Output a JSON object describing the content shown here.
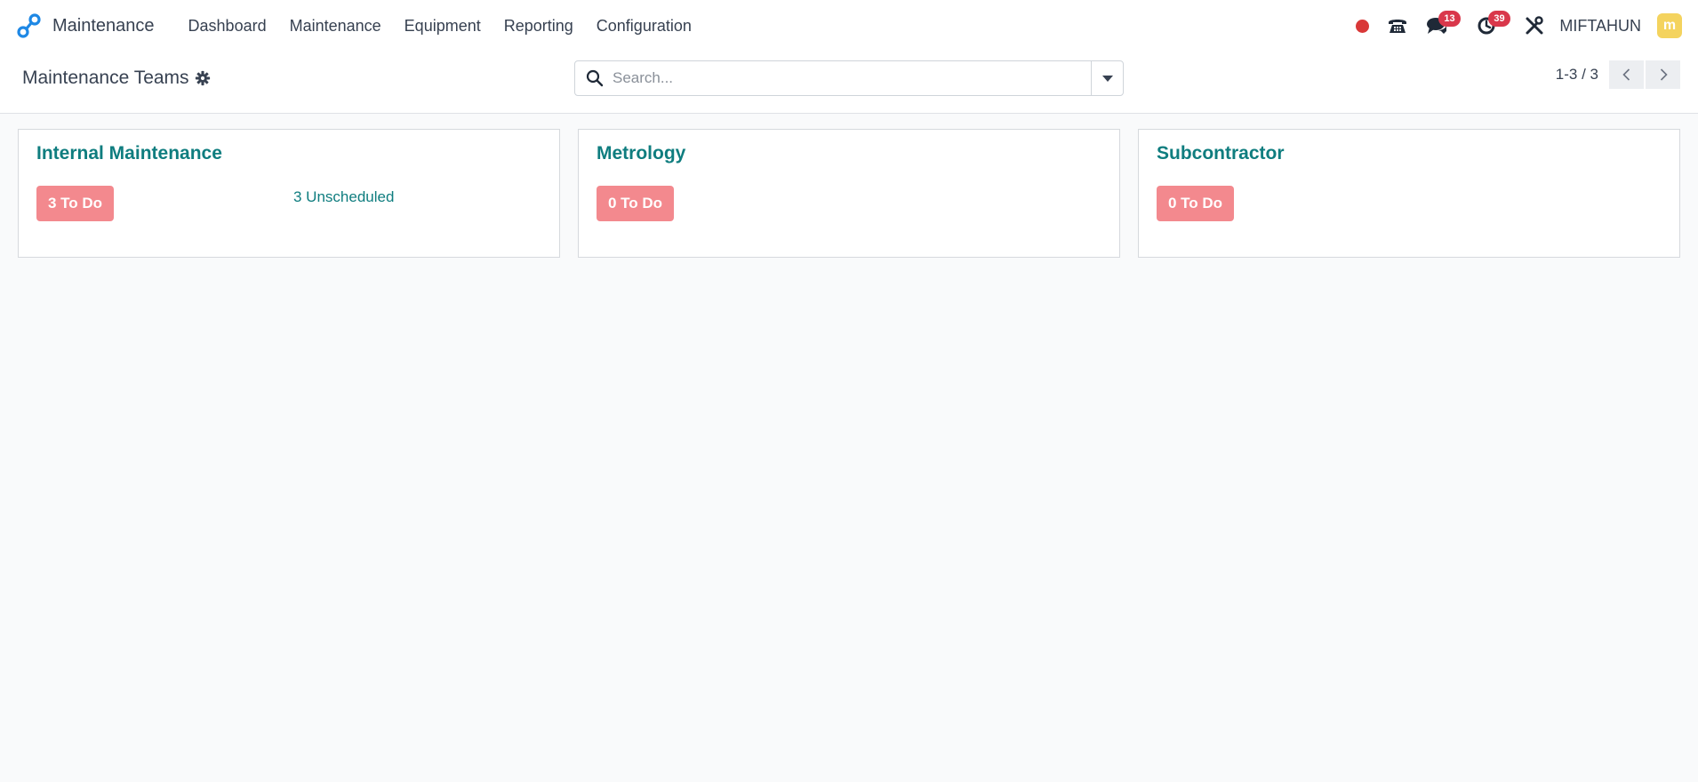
{
  "navbar": {
    "app_name": "Maintenance",
    "menu": [
      {
        "label": "Dashboard"
      },
      {
        "label": "Maintenance"
      },
      {
        "label": "Equipment"
      },
      {
        "label": "Reporting"
      },
      {
        "label": "Configuration"
      }
    ],
    "messages_count": "13",
    "activities_count": "39",
    "username": "MIFTAHUN",
    "avatar_initial": "m"
  },
  "control_panel": {
    "title": "Maintenance Teams",
    "search_placeholder": "Search...",
    "pager": "1-3 / 3"
  },
  "teams": [
    {
      "name": "Internal Maintenance",
      "todo_label": "3 To Do",
      "unscheduled_label": "3 Unscheduled"
    },
    {
      "name": "Metrology",
      "todo_label": "0 To Do"
    },
    {
      "name": "Subcontractor",
      "todo_label": "0 To Do"
    }
  ],
  "colors": {
    "accent": "#0f7d7f",
    "todo_badge": "#f3898e",
    "notification": "#d9374b",
    "brand_blue": "#1e88e5"
  }
}
